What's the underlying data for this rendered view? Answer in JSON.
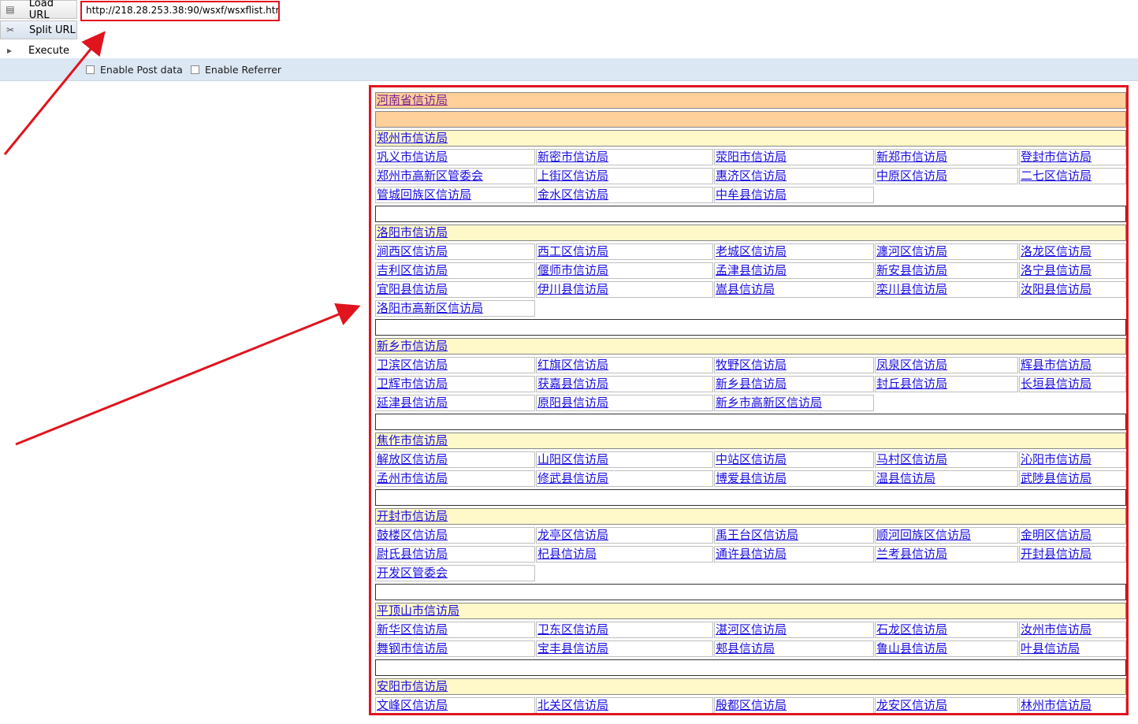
{
  "toolbar": {
    "load_label": "Load URL",
    "split_label": "Split URL",
    "execute_label": "Execute",
    "url_value": "http://218.28.253.38:90/wsxf/wsxflist.html",
    "enable_post_label": "Enable Post data",
    "enable_referrer_label": "Enable Referrer"
  },
  "province": "河南省信访局",
  "cities": [
    {
      "name": "郑州市信访局",
      "rows": [
        [
          "巩义市信访局",
          "新密市信访局",
          "荥阳市信访局",
          "新郑市信访局",
          "登封市信访局"
        ],
        [
          "郑州市高新区管委会",
          "上街区信访局",
          "惠济区信访局",
          "中原区信访局",
          "二七区信访局"
        ],
        [
          "管城回族区信访局",
          "金水区信访局",
          "中牟县信访局"
        ]
      ]
    },
    {
      "name": "洛阳市信访局",
      "rows": [
        [
          "涧西区信访局",
          "西工区信访局",
          "老城区信访局",
          "瀍河区信访局",
          "洛龙区信访局"
        ],
        [
          "吉利区信访局",
          "偃师市信访局",
          "孟津县信访局",
          "新安县信访局",
          "洛宁县信访局"
        ],
        [
          "宜阳县信访局",
          "伊川县信访局",
          "嵩县信访局",
          "栾川县信访局",
          "汝阳县信访局"
        ],
        [
          "洛阳市高新区信访局"
        ]
      ]
    },
    {
      "name": "新乡市信访局",
      "rows": [
        [
          "卫滨区信访局",
          "红旗区信访局",
          "牧野区信访局",
          "凤泉区信访局",
          "辉县市信访局"
        ],
        [
          "卫辉市信访局",
          "获嘉县信访局",
          "新乡县信访局",
          "封丘县信访局",
          "长垣县信访局"
        ],
        [
          "延津县信访局",
          "原阳县信访局",
          "新乡市高新区信访局"
        ]
      ]
    },
    {
      "name": "焦作市信访局",
      "rows": [
        [
          "解放区信访局",
          "山阳区信访局",
          "中站区信访局",
          "马村区信访局",
          "沁阳市信访局"
        ],
        [
          "孟州市信访局",
          "修武县信访局",
          "博爱县信访局",
          "温县信访局",
          "武陟县信访局"
        ]
      ]
    },
    {
      "name": "开封市信访局",
      "rows": [
        [
          "鼓楼区信访局",
          "龙亭区信访局",
          "禹王台区信访局",
          "顺河回族区信访局",
          "金明区信访局"
        ],
        [
          "尉氏县信访局",
          "杞县信访局",
          "通许县信访局",
          "兰考县信访局",
          "开封县信访局"
        ],
        [
          "开发区管委会"
        ]
      ]
    },
    {
      "name": "平顶山市信访局",
      "rows": [
        [
          "新华区信访局",
          "卫东区信访局",
          "湛河区信访局",
          "石龙区信访局",
          "汝州市信访局"
        ],
        [
          "舞钢市信访局",
          "宝丰县信访局",
          "郏县信访局",
          "鲁山县信访局",
          "叶县信访局"
        ]
      ]
    },
    {
      "name": "安阳市信访局",
      "rows": [
        [
          "文峰区信访局",
          "北关区信访局",
          "殷都区信访局",
          "龙安区信访局",
          "林州市信访局"
        ]
      ]
    }
  ]
}
